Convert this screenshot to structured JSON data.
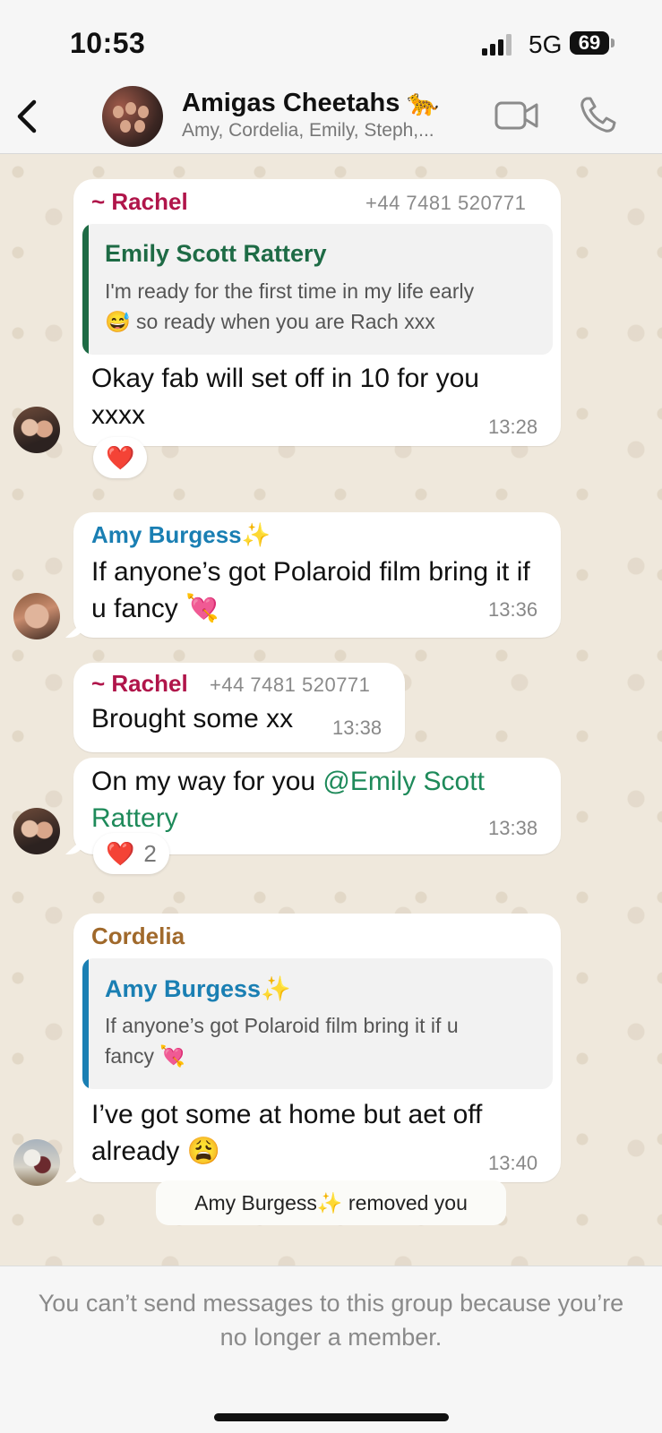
{
  "status_bar": {
    "time": "10:53",
    "network": "5G",
    "battery": "69"
  },
  "header": {
    "title": "Amigas Cheetahs 🐆",
    "subtitle": "Amy, Cordelia, Emily, Steph,...",
    "back_icon": "chevron-left-icon",
    "video_icon": "video-camera-icon",
    "call_icon": "phone-icon"
  },
  "colors": {
    "rachel": "#b0154a",
    "emily": "#1e6b45",
    "amy": "#1a7fb3",
    "cordelia": "#a0692b",
    "mention": "#1e8a5a"
  },
  "messages": [
    {
      "sender": "~ Rachel",
      "phone": "+44 7481 520771",
      "quote_name": "Emily Scott Rattery",
      "quote_line1": "I'm ready for the first time in my life early",
      "quote_line2": "😅 so ready when you are Rach xxx",
      "text": "Okay fab will set off in 10 for you xxxx",
      "time": "13:28",
      "reaction": "❤️"
    },
    {
      "sender": "Amy Burgess✨",
      "text": "If anyone’s got Polaroid film bring it if u fancy 💘",
      "time": "13:36"
    },
    {
      "sender": "~ Rachel",
      "phone": "+44 7481 520771",
      "text": "Brought some xx",
      "time": "13:38"
    },
    {
      "text_line1": "On my way for you ",
      "mention_line1": "@Emily Scott",
      "mention_line2": "Rattery",
      "time": "13:38",
      "reaction": "❤️",
      "reaction_count": "2"
    },
    {
      "sender": "Cordelia",
      "quote_name": "Amy Burgess✨",
      "quote_line1": "If anyone’s got Polaroid film bring it if u",
      "quote_line2": "fancy 💘",
      "text": "I’ve got some at home but aet off already 😩",
      "time": "13:40"
    }
  ],
  "system_message": "Amy Burgess✨ removed you",
  "footer": {
    "notice": "You can’t send messages to this group because you’re no longer a member."
  }
}
